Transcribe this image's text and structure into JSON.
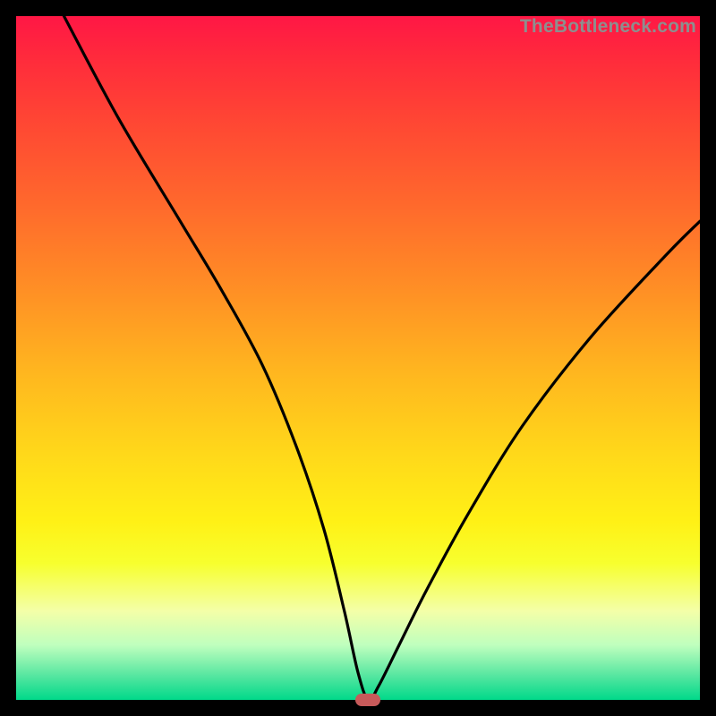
{
  "watermark": "TheBottleneck.com",
  "chart_data": {
    "type": "line",
    "title": "",
    "xlabel": "",
    "ylabel": "",
    "xlim": [
      0,
      100
    ],
    "ylim": [
      0,
      100
    ],
    "series": [
      {
        "name": "bottleneck-curve",
        "x": [
          7,
          15,
          24,
          30,
          36,
          41,
          45,
          48,
          50,
          51.5,
          53,
          56,
          60,
          66,
          74,
          84,
          95,
          100
        ],
        "values": [
          100,
          85,
          70,
          60,
          49,
          37,
          25,
          13,
          4,
          0,
          2,
          8,
          16,
          27,
          40,
          53,
          65,
          70
        ]
      }
    ],
    "marker": {
      "x": 51.5,
      "y": 0,
      "color": "#c75a5a"
    },
    "gradient_stops": [
      {
        "pos": 0.0,
        "color": "#ff1745"
      },
      {
        "pos": 0.4,
        "color": "#ff8f25"
      },
      {
        "pos": 0.74,
        "color": "#fff116"
      },
      {
        "pos": 0.92,
        "color": "#bfffbe"
      },
      {
        "pos": 1.0,
        "color": "#00d98a"
      }
    ]
  }
}
